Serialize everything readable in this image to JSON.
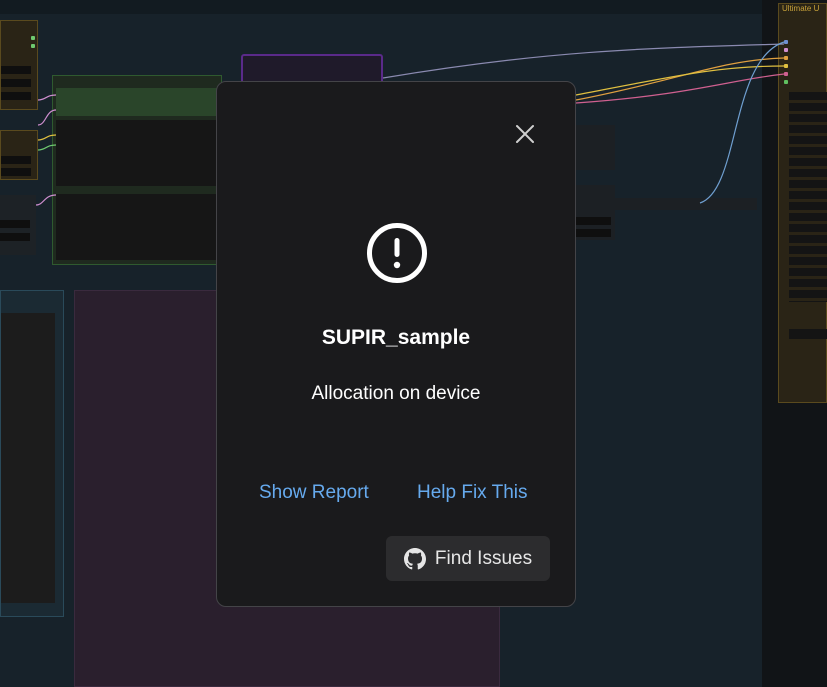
{
  "background": {
    "node_title_right": "Ultimate U"
  },
  "dialog": {
    "node_name": "SUPIR_sample",
    "error_message": "Allocation on device",
    "show_report_label": "Show Report",
    "help_fix_label": "Help Fix This",
    "find_issues_label": "Find Issues",
    "icons": {
      "close": "close-icon",
      "warning": "exclamation-circle-icon",
      "github": "github-icon"
    },
    "colors": {
      "dialog_bg": "#1a1a1c",
      "link": "#66aaee",
      "button_bg": "#2c2c2e"
    }
  }
}
